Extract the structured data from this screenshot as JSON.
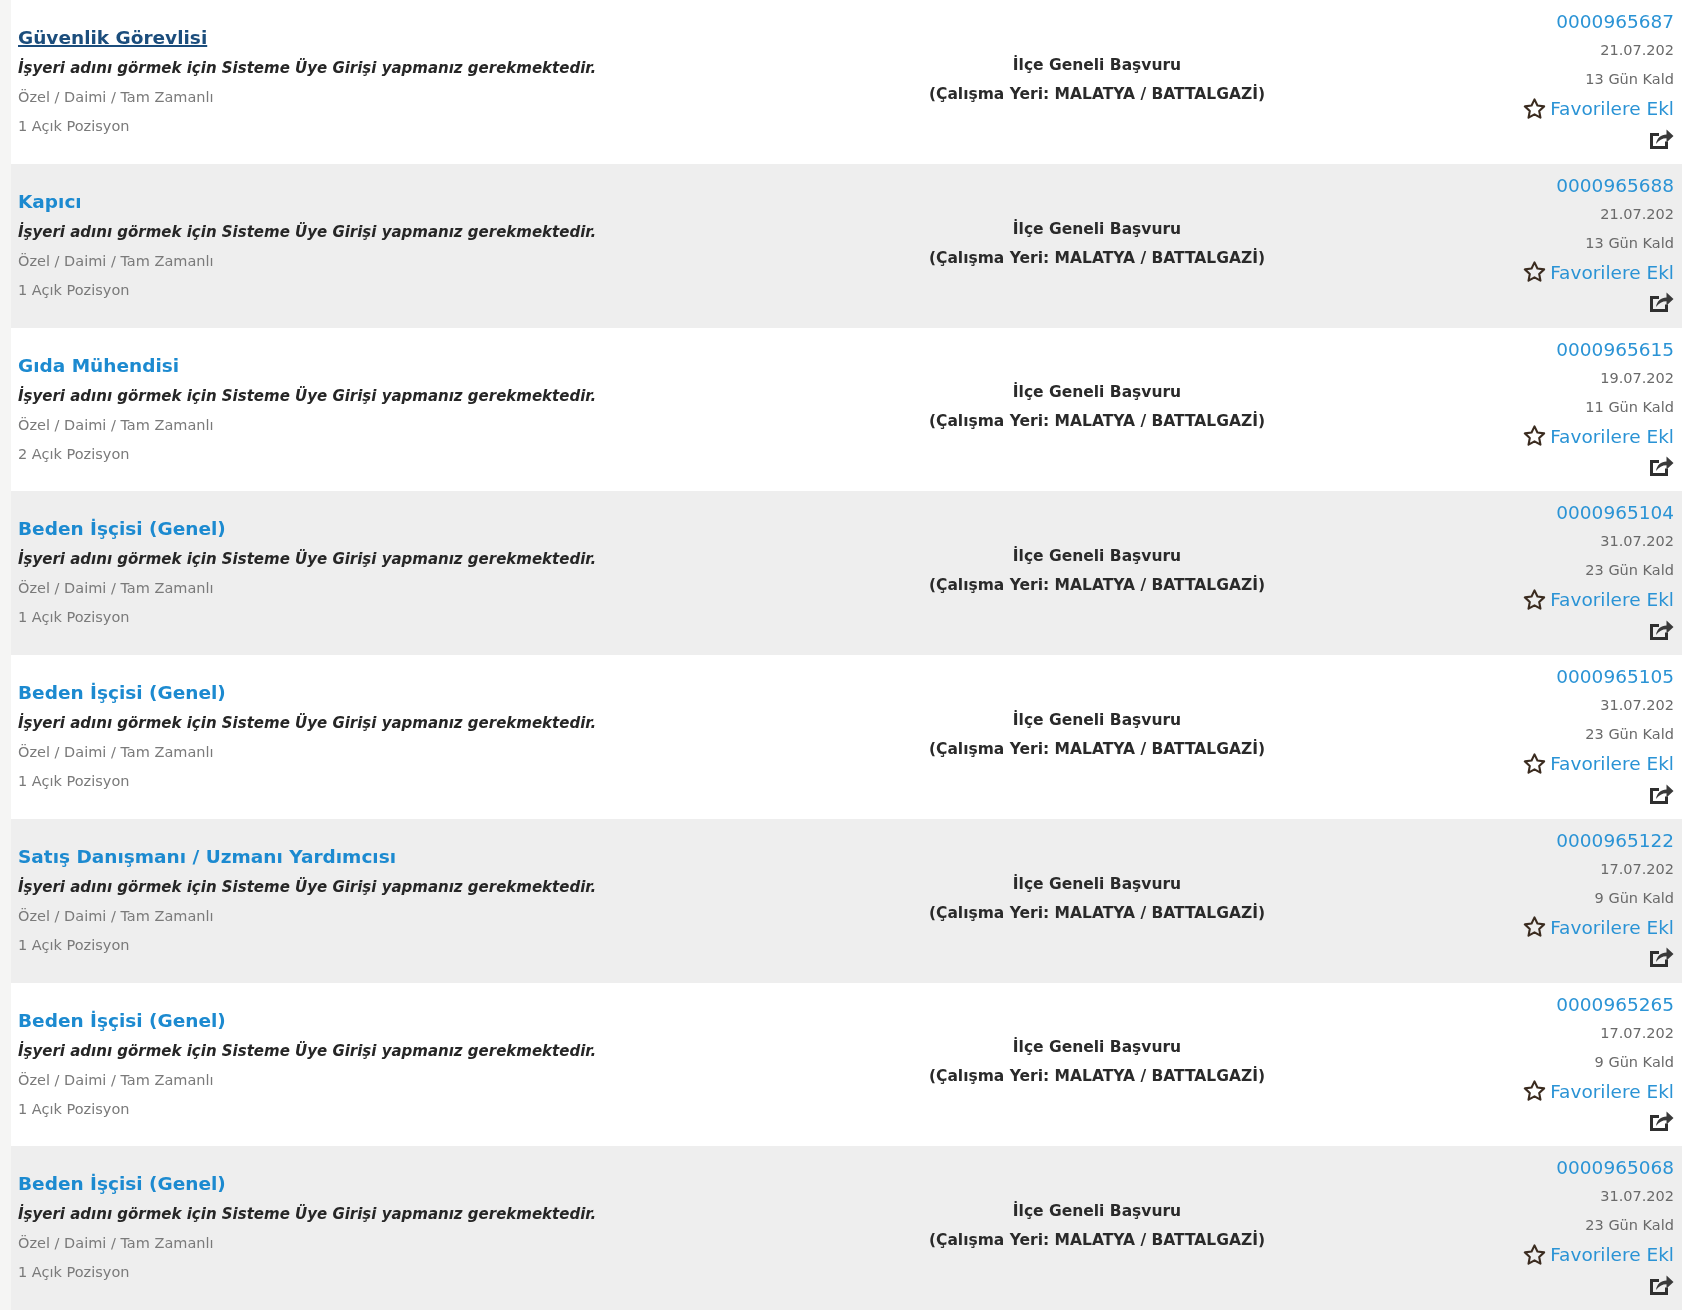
{
  "jobs": [
    {
      "title": "Güvenlik Görevlisi",
      "hovered": true,
      "employer_note": "İşyeri adını görmek için Sisteme Üye Girişi yapmanız gerekmektedir.",
      "job_type": "Özel / Daimi / Tam Zamanlı",
      "openings": "1 Açık Pozisyon",
      "application_scope": "İlçe Geneli Başvuru",
      "work_location": "(Çalışma Yeri: MALATYA / BATTALGAZİ)",
      "listing_number": "0000965687",
      "date": "21.07.202",
      "days_left": "13 Gün Kald",
      "favorite_label": "Favorilere Ekl"
    },
    {
      "title": "Kapıcı",
      "hovered": false,
      "employer_note": "İşyeri adını görmek için Sisteme Üye Girişi yapmanız gerekmektedir.",
      "job_type": "Özel / Daimi / Tam Zamanlı",
      "openings": "1 Açık Pozisyon",
      "application_scope": "İlçe Geneli Başvuru",
      "work_location": "(Çalışma Yeri: MALATYA / BATTALGAZİ)",
      "listing_number": "0000965688",
      "date": "21.07.202",
      "days_left": "13 Gün Kald",
      "favorite_label": "Favorilere Ekl"
    },
    {
      "title": "Gıda Mühendisi",
      "hovered": false,
      "employer_note": "İşyeri adını görmek için Sisteme Üye Girişi yapmanız gerekmektedir.",
      "job_type": "Özel / Daimi / Tam Zamanlı",
      "openings": "2 Açık Pozisyon",
      "application_scope": "İlçe Geneli Başvuru",
      "work_location": "(Çalışma Yeri: MALATYA / BATTALGAZİ)",
      "listing_number": "0000965615",
      "date": "19.07.202",
      "days_left": "11 Gün Kald",
      "favorite_label": "Favorilere Ekl"
    },
    {
      "title": "Beden İşçisi (Genel)",
      "hovered": false,
      "employer_note": "İşyeri adını görmek için Sisteme Üye Girişi yapmanız gerekmektedir.",
      "job_type": "Özel / Daimi / Tam Zamanlı",
      "openings": "1 Açık Pozisyon",
      "application_scope": "İlçe Geneli Başvuru",
      "work_location": "(Çalışma Yeri: MALATYA / BATTALGAZİ)",
      "listing_number": "0000965104",
      "date": "31.07.202",
      "days_left": "23 Gün Kald",
      "favorite_label": "Favorilere Ekl"
    },
    {
      "title": "Beden İşçisi (Genel)",
      "hovered": false,
      "employer_note": "İşyeri adını görmek için Sisteme Üye Girişi yapmanız gerekmektedir.",
      "job_type": "Özel / Daimi / Tam Zamanlı",
      "openings": "1 Açık Pozisyon",
      "application_scope": "İlçe Geneli Başvuru",
      "work_location": "(Çalışma Yeri: MALATYA / BATTALGAZİ)",
      "listing_number": "0000965105",
      "date": "31.07.202",
      "days_left": "23 Gün Kald",
      "favorite_label": "Favorilere Ekl"
    },
    {
      "title": "Satış Danışmanı / Uzmanı Yardımcısı",
      "hovered": false,
      "employer_note": "İşyeri adını görmek için Sisteme Üye Girişi yapmanız gerekmektedir.",
      "job_type": "Özel / Daimi / Tam Zamanlı",
      "openings": "1 Açık Pozisyon",
      "application_scope": "İlçe Geneli Başvuru",
      "work_location": "(Çalışma Yeri: MALATYA / BATTALGAZİ)",
      "listing_number": "0000965122",
      "date": "17.07.202",
      "days_left": "9 Gün Kald",
      "favorite_label": "Favorilere Ekl"
    },
    {
      "title": "Beden İşçisi (Genel)",
      "hovered": false,
      "employer_note": "İşyeri adını görmek için Sisteme Üye Girişi yapmanız gerekmektedir.",
      "job_type": "Özel / Daimi / Tam Zamanlı",
      "openings": "1 Açık Pozisyon",
      "application_scope": "İlçe Geneli Başvuru",
      "work_location": "(Çalışma Yeri: MALATYA / BATTALGAZİ)",
      "listing_number": "0000965265",
      "date": "17.07.202",
      "days_left": "9 Gün Kald",
      "favorite_label": "Favorilere Ekl"
    },
    {
      "title": "Beden İşçisi (Genel)",
      "hovered": false,
      "employer_note": "İşyeri adını görmek için Sisteme Üye Girişi yapmanız gerekmektedir.",
      "job_type": "Özel / Daimi / Tam Zamanlı",
      "openings": "1 Açık Pozisyon",
      "application_scope": "İlçe Geneli Başvuru",
      "work_location": "(Çalışma Yeri: MALATYA / BATTALGAZİ)",
      "listing_number": "0000965068",
      "date": "31.07.202",
      "days_left": "23 Gün Kald",
      "favorite_label": "Favorilere Ekl"
    }
  ]
}
